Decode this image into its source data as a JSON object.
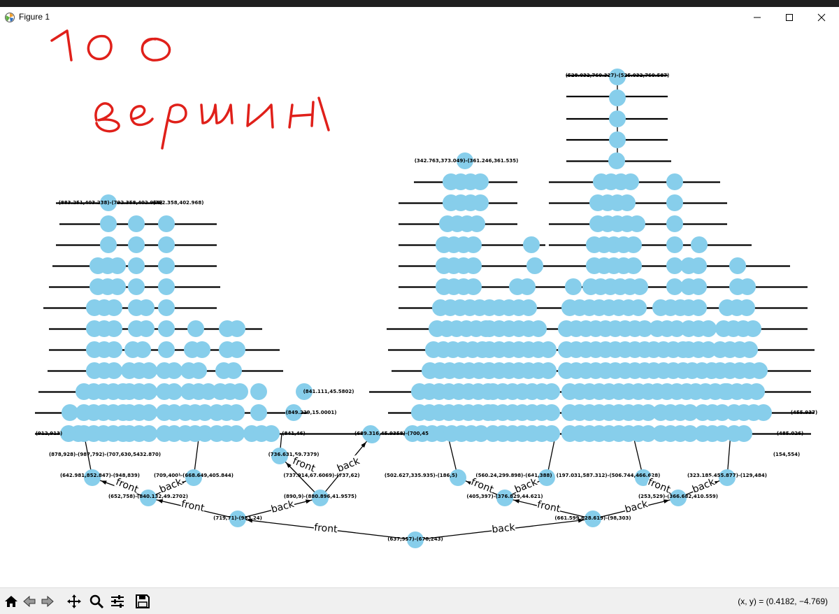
{
  "window": {
    "title": "Figure 1",
    "icons": [
      "matplotlib-logo-icon",
      "minimize-icon",
      "maximize-icon",
      "close-icon"
    ]
  },
  "annotation": {
    "number": "100",
    "word": "вершин",
    "color": "#e0201a"
  },
  "graph": {
    "node_color": "#87ceeb",
    "edge_color": "#000000",
    "root_label": "(637,957)-(678,243)",
    "level1": [
      {
        "label": "(719,71)-(983,24)"
      },
      {
        "label": "(661.599,628.619)-(98,303)"
      }
    ],
    "level2": [
      {
        "label": "(652,758)-(840.132,49.2702)"
      },
      {
        "label": "(890,9)-(880.896,41.9575)"
      },
      {
        "label": "(405,397)-(376.829,44.621)"
      },
      {
        "label": "(253,529)-(366.682,410.559)"
      }
    ],
    "level3": [
      {
        "label": "(642.981,852.847)-(948,839)"
      },
      {
        "label": "(709,400)-(668.649,405.844)"
      },
      {
        "label": "(737.914,67.6069)-(737,62)"
      },
      {
        "label": "(502.627,335.935)-(186,5)"
      },
      {
        "label": "(560.24,299.898)-(641,388)"
      },
      {
        "label": "(197.031,587.312)-(506.744,466.628)"
      },
      {
        "label": "(323.185,455.877)-(129,484)"
      }
    ],
    "misc_labels": [
      "(878,928)-(987,792)-(707,630,5432.870)",
      "(689.316,45.9358)-(700,45",
      "(736.631,59.7379)",
      "(841,46)",
      "(849.229,15.0001)",
      "(841.111,45.5802)",
      "(912,913)",
      "(342.763,373.049)-(361.246,361.535)",
      "(528.032,760.327)-(525.032,760.587)",
      "(792.358,402.968)",
      "(883.251,403.238)-(792.358,402.968)",
      "(485.026)",
      "(154,554)",
      "(455.937)"
    ],
    "edge_labels": [
      "front",
      "back"
    ]
  },
  "toolbar": {
    "buttons": [
      "home-icon",
      "back-icon",
      "forward-icon",
      "pan-icon",
      "zoom-icon",
      "configure-icon",
      "save-icon"
    ],
    "coords": "(x, y) = (0.4182, −4.769)"
  }
}
